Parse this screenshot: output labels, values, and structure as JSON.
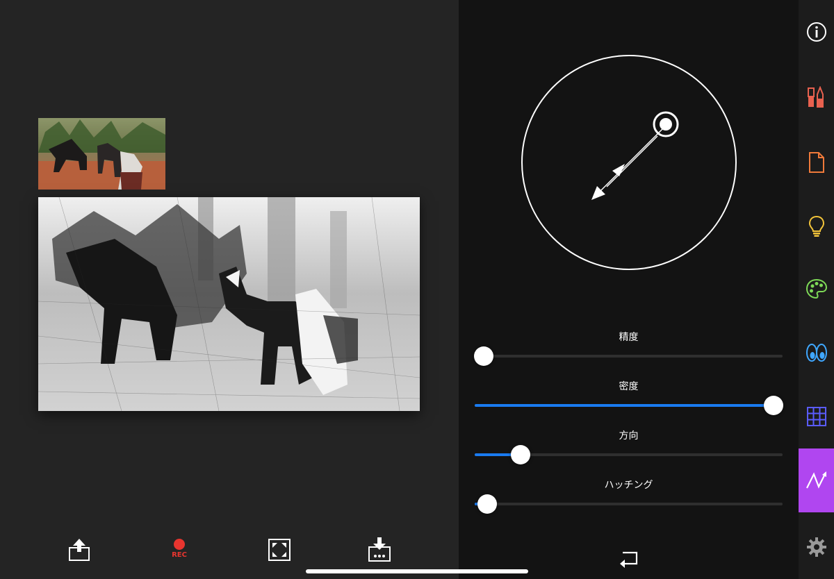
{
  "colors": {
    "slider_accent": "#1a7bf0",
    "rec_red": "#e8352f",
    "active_tool_bg": "#b046f0"
  },
  "canvas": {
    "thumbnail": {
      "icon": "color-photo-donkeys"
    },
    "artwork": {
      "icon": "pencil-sketch-donkeys"
    },
    "bottom_toolbar": {
      "share": {
        "icon": "share-icon"
      },
      "record": {
        "icon": "record-icon",
        "label": "REC"
      },
      "fullscreen": {
        "icon": "fullscreen-icon"
      },
      "save": {
        "icon": "save-icon"
      }
    }
  },
  "panel": {
    "direction_dial": {
      "icon": "direction-dial",
      "angle_deg": 225
    },
    "sliders": [
      {
        "label": "精度",
        "value": 0.03
      },
      {
        "label": "密度",
        "value": 0.97
      },
      {
        "label": "方向",
        "value": 0.15
      },
      {
        "label": "ハッチング",
        "value": 0.04
      }
    ],
    "return_button": {
      "icon": "return-icon"
    }
  },
  "toolbar": {
    "items": [
      {
        "name": "info",
        "icon": "info-icon",
        "color": "#ffffff"
      },
      {
        "name": "brushes",
        "icon": "brushes-icon",
        "color": "#e8614f"
      },
      {
        "name": "document",
        "icon": "document-icon",
        "color": "#f07a3a"
      },
      {
        "name": "ideas",
        "icon": "lightbulb-icon",
        "color": "#f3c43a"
      },
      {
        "name": "palette",
        "icon": "palette-icon",
        "color": "#7ed957"
      },
      {
        "name": "eyes",
        "icon": "eyes-icon",
        "color": "#3fa7ff"
      },
      {
        "name": "grid",
        "icon": "grid-icon",
        "color": "#5a5cff"
      },
      {
        "name": "stroke",
        "icon": "zigzag-stroke-icon",
        "color": "#ffffff",
        "active": true
      },
      {
        "name": "settings",
        "icon": "gear-icon",
        "color": "#9a9a9a"
      }
    ]
  }
}
